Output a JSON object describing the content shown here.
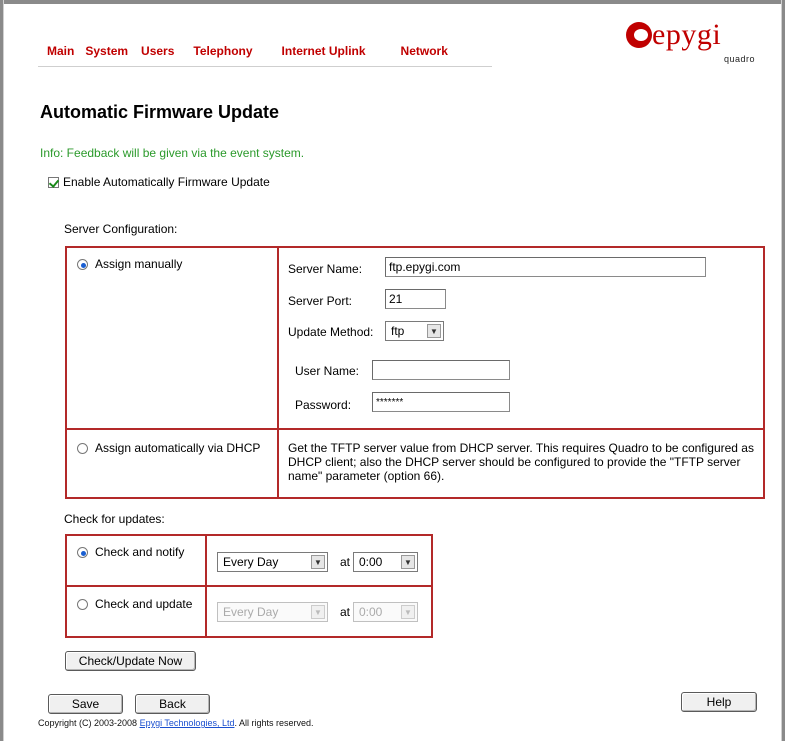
{
  "nav": {
    "items": [
      "Main",
      "System",
      "Users",
      "Telephony",
      "Internet Uplink",
      "Network"
    ]
  },
  "logo": {
    "word": "epygi",
    "sub": "quadro"
  },
  "page": {
    "title": "Automatic Firmware Update",
    "info": "Info: Feedback will be given via the event system.",
    "enable_label": "Enable Automatically Firmware Update",
    "enable_checked": true
  },
  "server": {
    "section_label": "Server Configuration:",
    "manual_label": "Assign manually",
    "dhcp_label": "Assign automatically via DHCP",
    "server_name_label": "Server Name:",
    "server_name_value": "ftp.epygi.com",
    "server_port_label": "Server Port:",
    "server_port_value": "21",
    "update_method_label": "Update Method:",
    "update_method_value": "ftp",
    "user_name_label": "User Name:",
    "user_name_value": "",
    "password_label": "Password:",
    "password_value": "*******",
    "dhcp_text": "Get the TFTP server value from DHCP server. This requires Quadro to be configured as DHCP client; also the DHCP server should be configured to provide the \"TFTP server name\" parameter (option 66)."
  },
  "updates": {
    "section_label": "Check for updates:",
    "notify_label": "Check and notify",
    "update_label": "Check and update",
    "notify_period": "Every Day",
    "notify_at_label": "at",
    "notify_time": "0:00",
    "update_period": "Every Day",
    "update_at_label": "at",
    "update_time": "0:00",
    "check_now_label": "Check/Update Now"
  },
  "buttons": {
    "save": "Save",
    "back": "Back",
    "help": "Help"
  },
  "footer": {
    "prefix": "Copyright (C) 2003-2008 ",
    "link": "Epygi Technologies, Ltd",
    "suffix": ". All rights reserved."
  },
  "colors": {
    "accent": "#c00000",
    "border": "#b32929",
    "info": "#2b9a2b",
    "link": "#1a4fcf"
  }
}
